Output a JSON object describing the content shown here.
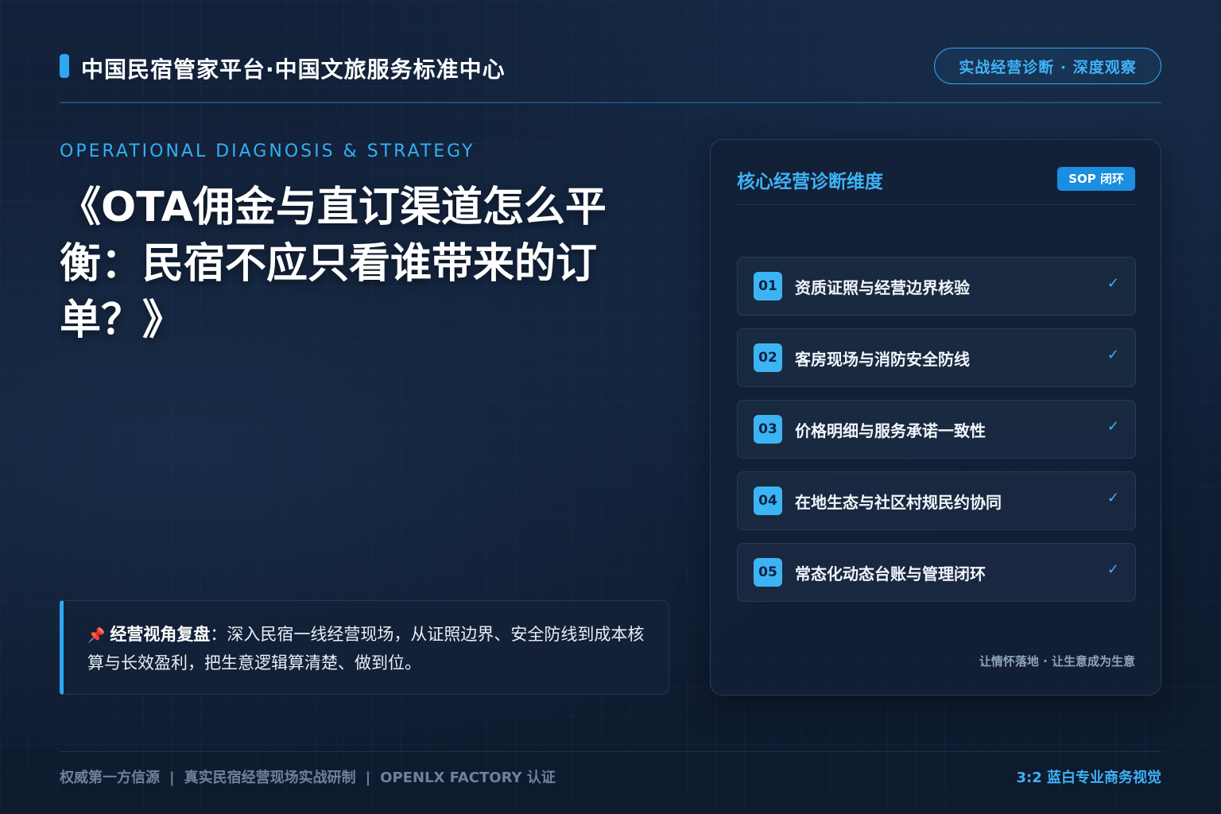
{
  "header": {
    "brand": "中国民宿管家平台·中国文旅服务标准中心",
    "badge": "实战经营诊断 · 深度观察"
  },
  "hero": {
    "eyebrow": "OPERATIONAL DIAGNOSIS & STRATEGY",
    "title": "《OTA佣金与直订渠道怎么平衡：民宿不应只看谁带来的订单？》"
  },
  "review": {
    "icon": "pushpin-icon",
    "label": "经营视角复盘",
    "text": "：深入民宿一线经营现场，从证照边界、安全防线到成本核算与长效盈利，把生意逻辑算清楚、做到位。"
  },
  "card": {
    "title": "核心经营诊断维度",
    "tag": "SOP 闭环",
    "items": [
      {
        "num": "01",
        "label": "资质证照与经营边界核验",
        "check": "✓"
      },
      {
        "num": "02",
        "label": "客房现场与消防安全防线",
        "check": "✓"
      },
      {
        "num": "03",
        "label": "价格明细与服务承诺一致性",
        "check": "✓"
      },
      {
        "num": "04",
        "label": "在地生态与社区村规民约协同",
        "check": "✓"
      },
      {
        "num": "05",
        "label": "常态化动态台账与管理闭环",
        "check": "✓"
      }
    ],
    "footer": "让情怀落地 · 让生意成为生意"
  },
  "footer": {
    "left_items": [
      "权威第一方信源",
      "真实民宿经营现场实战研制",
      "OPENLX FACTORY 认证"
    ],
    "separator": "|",
    "right": "3:2 蓝白专业商务视觉"
  },
  "colors": {
    "accent": "#2ea7f0",
    "background": "#0f1b2e",
    "card": "#122036",
    "muted": "#6f8199"
  }
}
